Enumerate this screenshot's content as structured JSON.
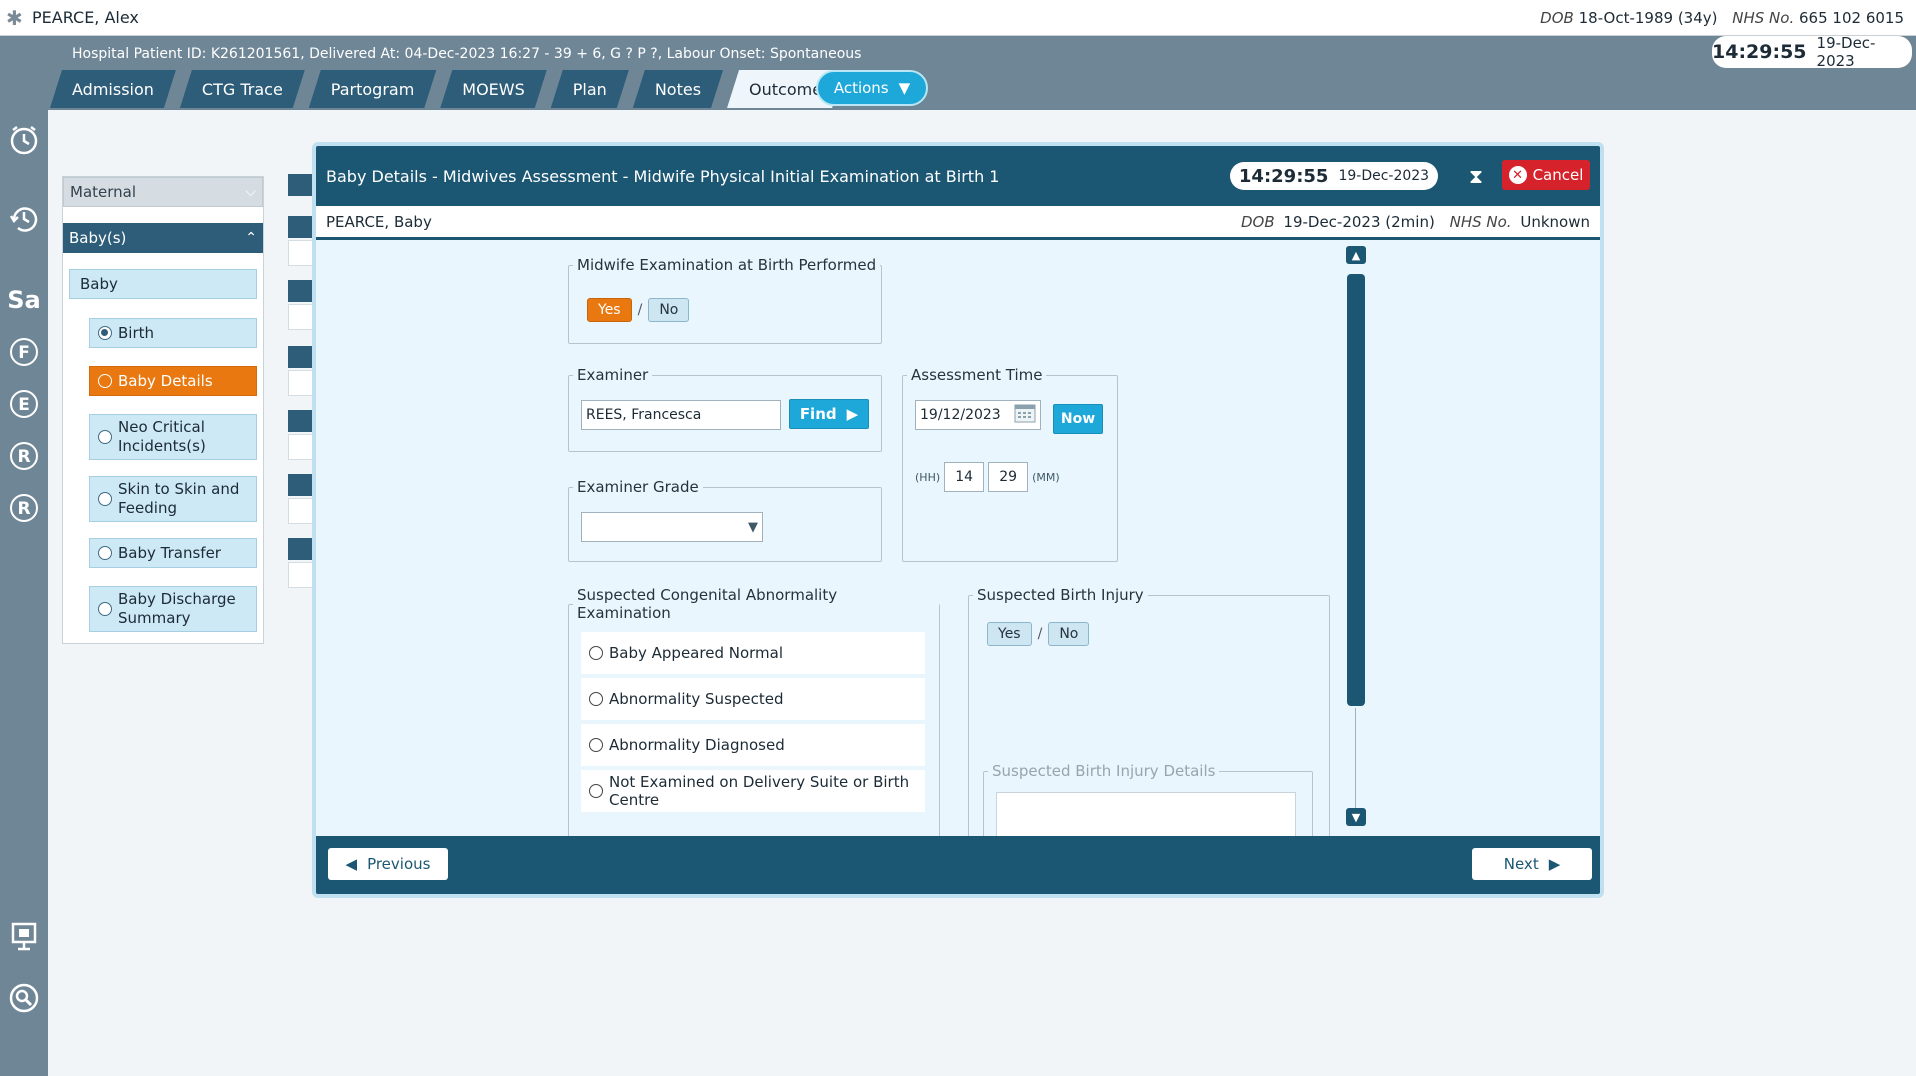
{
  "patient": {
    "name": "PEARCE, Alex",
    "dob_label": "DOB",
    "dob": "18-Oct-1989 (34y)",
    "nhs_label": "NHS No.",
    "nhs": "665 102 6015"
  },
  "header": {
    "info": "Hospital Patient ID: K261201561, Delivered At: 04-Dec-2023 16:27 - 39 + 6, G ? P ?,   Labour Onset: Spontaneous",
    "tabs": [
      {
        "label": "Admission"
      },
      {
        "label": "CTG Trace"
      },
      {
        "label": "Partogram"
      },
      {
        "label": "MOEWS"
      },
      {
        "label": "Plan"
      },
      {
        "label": "Notes"
      },
      {
        "label": "Outcome"
      }
    ],
    "actions_label": "Actions",
    "clock_time": "14:29:55",
    "clock_date": "19-Dec-2023"
  },
  "rail": {
    "icons": [
      "alarm-clock-icon",
      "history-clock-icon",
      "sa-icon",
      "f-icon",
      "e-icon",
      "r-icon",
      "r2-icon",
      "presentation-icon",
      "search-icon"
    ],
    "letters": {
      "sa": "Sa",
      "f": "F",
      "e": "E",
      "r": "R",
      "r2": "R"
    }
  },
  "nav": {
    "maternal": "Maternal",
    "babies": "Baby(s)",
    "baby": "Baby",
    "items": [
      {
        "label": "Birth"
      },
      {
        "label": "Baby Details"
      },
      {
        "label": "Neo Critical Incidents(s)"
      },
      {
        "label": "Skin to Skin and Feeding"
      },
      {
        "label": "Baby Transfer"
      },
      {
        "label": "Baby Discharge Summary"
      }
    ]
  },
  "modal": {
    "title": "Baby Details - Midwives Assessment - Midwife Physical Initial Examination at Birth 1",
    "clock_time": "14:29:55",
    "clock_date": "19-Dec-2023",
    "cancel_label": "Cancel",
    "baby_name": "PEARCE, Baby",
    "dob_label": "DOB",
    "dob": "19-Dec-2023 (2min)",
    "nhs_label": "NHS No.",
    "nhs": "Unknown",
    "exam_performed": {
      "legend": "Midwife Examination at Birth Performed",
      "yes": "Yes",
      "no": "No",
      "slash": "/"
    },
    "examiner": {
      "legend": "Examiner",
      "value": "REES, Francesca",
      "find_label": "Find"
    },
    "examiner_grade": {
      "legend": "Examiner Grade",
      "value": ""
    },
    "assessment_time": {
      "legend": "Assessment Time",
      "date": "19/12/2023",
      "now_label": "Now",
      "hh_label": "(HH)",
      "hh": "14",
      "mm": "29",
      "mm_label": "(MM)"
    },
    "congenital": {
      "legend": "Suspected Congenital Abnormality Examination",
      "options": [
        {
          "label": "Baby Appeared Normal"
        },
        {
          "label": "Abnormality Suspected"
        },
        {
          "label": "Abnormality Diagnosed"
        },
        {
          "label": "Not Examined on Delivery Suite or Birth Centre"
        }
      ]
    },
    "birth_injury": {
      "legend": "Suspected Birth Injury",
      "yes": "Yes",
      "no": "No",
      "slash": "/",
      "details_legend": "Suspected Birth Injury Details"
    },
    "previous_label": "Previous",
    "next_label": "Next"
  },
  "colors": {
    "header": "#6f8696",
    "dark_blue": "#1b5672",
    "accent_orange": "#e8780f",
    "button_blue": "#1ea7d9",
    "cancel_red": "#d6232b"
  }
}
